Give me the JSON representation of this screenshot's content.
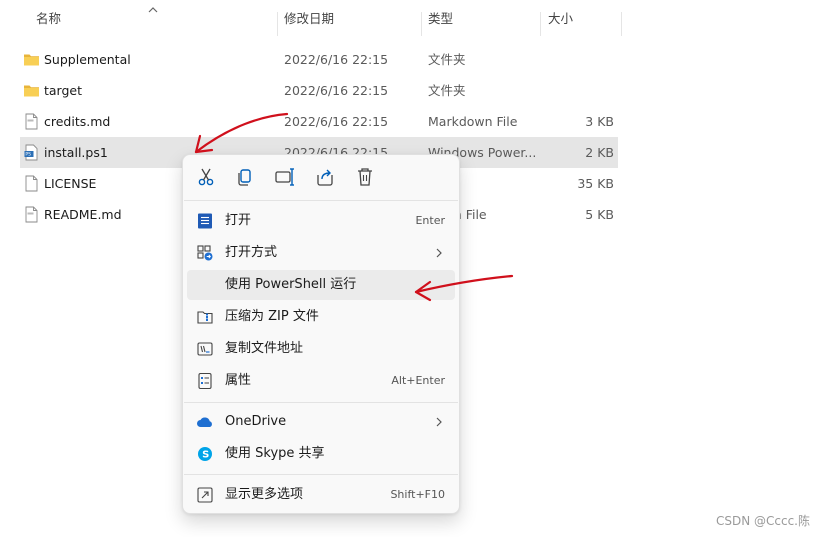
{
  "columns": {
    "name": "名称",
    "date": "修改日期",
    "type": "类型",
    "size": "大小"
  },
  "files": [
    {
      "name": "Supplemental",
      "date": "2022/6/16 22:15",
      "type": "文件夹",
      "size": "",
      "icon": "folder-icon"
    },
    {
      "name": "target",
      "date": "2022/6/16 22:15",
      "type": "文件夹",
      "size": "",
      "icon": "folder-icon"
    },
    {
      "name": "credits.md",
      "date": "2022/6/16 22:15",
      "type": "Markdown File",
      "size": "3 KB",
      "icon": "md-file-icon"
    },
    {
      "name": "install.ps1",
      "date": "2022/6/16 22:15",
      "type": "Windows Power...",
      "size": "2 KB",
      "icon": "ps1-file-icon"
    },
    {
      "name": "LICENSE",
      "date": "",
      "type": "",
      "size": "35 KB",
      "icon": "file-icon"
    },
    {
      "name": "README.md",
      "date": "",
      "type": "down File",
      "size": "5 KB",
      "icon": "md-file-icon"
    }
  ],
  "context_menu": {
    "quick_actions": [
      "cut-icon",
      "copy-icon",
      "rename-icon",
      "share-icon",
      "delete-icon"
    ],
    "items": [
      {
        "label": "打开",
        "shortcut": "Enter",
        "icon": "open-icon"
      },
      {
        "label": "打开方式",
        "shortcut": "",
        "icon": "open-with-icon",
        "submenu": true
      },
      {
        "label": "使用 PowerShell 运行",
        "shortcut": "",
        "icon": "",
        "highlighted": true
      },
      {
        "label": "压缩为 ZIP 文件",
        "shortcut": "",
        "icon": "zip-icon"
      },
      {
        "label": "复制文件地址",
        "shortcut": "",
        "icon": "copy-path-icon"
      },
      {
        "label": "属性",
        "shortcut": "Alt+Enter",
        "icon": "properties-icon"
      },
      {
        "label": "OneDrive",
        "shortcut": "",
        "icon": "onedrive-icon",
        "submenu": true
      },
      {
        "label": "使用 Skype 共享",
        "shortcut": "",
        "icon": "skype-icon"
      },
      {
        "label": "显示更多选项",
        "shortcut": "Shift+F10",
        "icon": "more-options-icon"
      }
    ]
  },
  "watermark": "CSDN @Cccc.陈",
  "colors": {
    "accent": "#005fb8",
    "annotation": "#d0101c",
    "selection": "#e5e5e5"
  }
}
